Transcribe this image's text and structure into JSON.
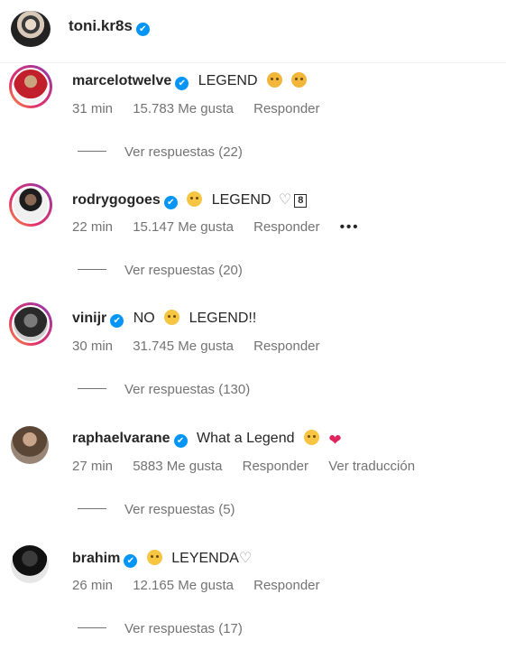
{
  "post": {
    "username": "toni.kr8s",
    "verified": true
  },
  "comments": [
    {
      "username": "marcelotwelve",
      "text": "LEGEND",
      "emojis_after": [
        "sad-face-emoji",
        "weary-face-emoji"
      ],
      "time": "31 min",
      "likes": "15.783 Me gusta",
      "reply_label": "Responder",
      "view_replies": "Ver respuestas (22)"
    },
    {
      "username": "rodrygogoes",
      "text": "LEGEND",
      "emoji_before": "pleading-face-emoji",
      "like_count_badge": "8",
      "time": "22 min",
      "likes": "15.147 Me gusta",
      "reply_label": "Responder",
      "more_label": "•••",
      "view_replies": "Ver respuestas (20)"
    },
    {
      "username": "vinijr",
      "text_before": "NO",
      "emoji": "pleading-face-emoji",
      "text": "LEGEND!!",
      "time": "30 min",
      "likes": "31.745 Me gusta",
      "reply_label": "Responder",
      "view_replies": "Ver respuestas (130)"
    },
    {
      "username": "raphaelvarane",
      "text": "What a Legend",
      "emojis_after": [
        "clapping-emoji",
        "red-heart-emoji"
      ],
      "time": "27 min",
      "likes": "5883 Me gusta",
      "reply_label": "Responder",
      "translate_label": "Ver traducción",
      "view_replies": "Ver respuestas (5)"
    },
    {
      "username": "brahim",
      "text": "LEYENDA",
      "emoji_before": "pleading-face-emoji",
      "time": "26 min",
      "likes": "12.165 Me gusta",
      "reply_label": "Responder",
      "view_replies": "Ver respuestas (17)"
    }
  ],
  "icons": {
    "verified": "✔",
    "heart_outline": "♡",
    "heart_red": "❤"
  },
  "colors": {
    "verified_blue": "#0095f6",
    "muted_text": "#737373",
    "primary_text": "#262626",
    "heart_red": "#e0245e"
  }
}
